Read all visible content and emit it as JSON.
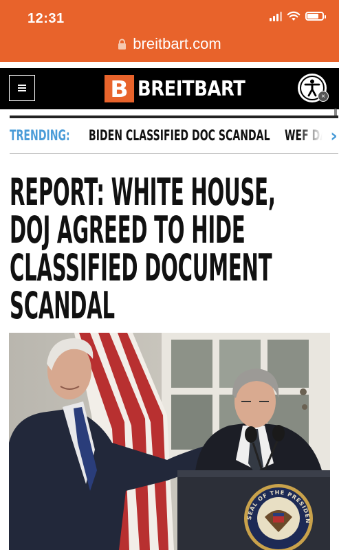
{
  "status_bar": {
    "time": "12:31"
  },
  "browser": {
    "url": "breitbart.com"
  },
  "header": {
    "logo_letter": "B",
    "logo_text": "BREITBART",
    "menu_icon": "hamburger-icon",
    "a11y_icon": "accessibility-icon"
  },
  "trending": {
    "label": "TRENDING:",
    "items": [
      "BIDEN CLASSIFIED DOC SCANDAL",
      "WEF DA"
    ]
  },
  "article": {
    "headline_lines": [
      "REPORT: WHITE HOUSE,",
      "DOJ AGREED TO HIDE",
      "CLASSIFIED DOCUMENT",
      "SCANDAL"
    ],
    "seal_text": "SEAL OF THE PRESIDENT OF THE UNITED STATES"
  },
  "colors": {
    "brand_orange": "#E8632B",
    "trending_blue": "#4a9cd8",
    "header_black": "#000000"
  }
}
